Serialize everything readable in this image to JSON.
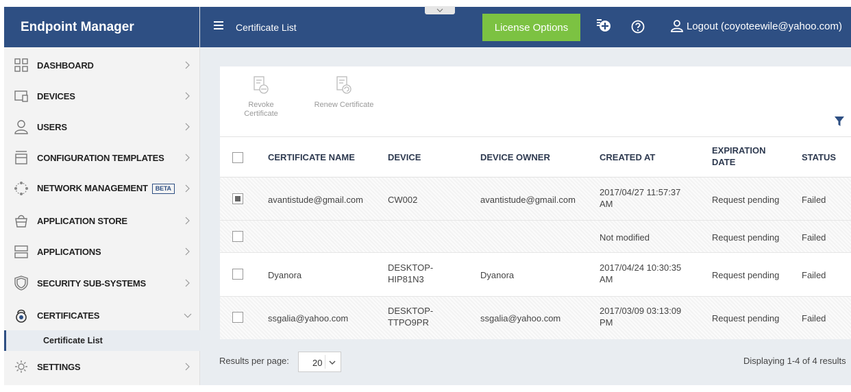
{
  "app": {
    "title": "Endpoint Manager"
  },
  "sidebar": {
    "items": [
      {
        "label": "DASHBOARD",
        "icon": "dashboard-grid-icon"
      },
      {
        "label": "DEVICES",
        "icon": "devices-icon"
      },
      {
        "label": "USERS",
        "icon": "user-icon"
      },
      {
        "label": "CONFIGURATION TEMPLATES",
        "icon": "template-icon"
      },
      {
        "label": "NETWORK MANAGEMENT",
        "icon": "network-icon",
        "badge": "BETA"
      },
      {
        "label": "APPLICATION STORE",
        "icon": "store-icon"
      },
      {
        "label": "APPLICATIONS",
        "icon": "applications-icon"
      },
      {
        "label": "SECURITY SUB-SYSTEMS",
        "icon": "shield-icon"
      },
      {
        "label": "CERTIFICATES",
        "icon": "certificate-icon",
        "expanded": true
      },
      {
        "label": "SETTINGS",
        "icon": "gear-icon"
      }
    ],
    "sub_item": "Certificate List"
  },
  "topbar": {
    "page_title": "Certificate List",
    "license_button": "License Options",
    "logout": "Logout (coyoteewile@yahoo.com)"
  },
  "toolbar": {
    "revoke_line1": "Revoke",
    "revoke_line2": "Certificate",
    "renew": "Renew Certificate"
  },
  "table": {
    "headers": {
      "name": "CERTIFICATE NAME",
      "device": "DEVICE",
      "owner": "DEVICE OWNER",
      "created": "CREATED AT",
      "expiration_line1": "EXPIRATION",
      "expiration_line2": "DATE",
      "status": "STATUS"
    },
    "rows": [
      {
        "checked": true,
        "name": "avantistude@gmail.com",
        "device1": "CW002",
        "device2": "",
        "owner": "avantistude@gmail.com",
        "created1": "2017/04/27 11:57:37",
        "created2": "AM",
        "expiration": "Request pending",
        "status": "Failed"
      },
      {
        "checked": false,
        "name": "",
        "device1": "",
        "device2": "",
        "owner": "",
        "created1": "Not modified",
        "created2": "",
        "expiration": "Request pending",
        "status": "Failed"
      },
      {
        "checked": false,
        "name": "Dyanora",
        "device1": "DESKTOP-",
        "device2": "HIP81N3",
        "owner": "Dyanora",
        "created1": "2017/04/24 10:30:35",
        "created2": "AM",
        "expiration": "Request pending",
        "status": "Failed"
      },
      {
        "checked": false,
        "name": "ssgalia@yahoo.com",
        "device1": "DESKTOP-",
        "device2": "TTPO9PR",
        "owner": "ssgalia@yahoo.com",
        "created1": "2017/03/09 03:13:09",
        "created2": "PM",
        "expiration": "Request pending",
        "status": "Failed"
      }
    ]
  },
  "footer": {
    "results_per_page_label": "Results per page:",
    "results_per_page_value": "20",
    "displaying": "Displaying 1-4 of 4 results"
  },
  "colors": {
    "brand": "#2e4f83",
    "license": "#7cc242",
    "content_bg": "#e9edf1"
  }
}
